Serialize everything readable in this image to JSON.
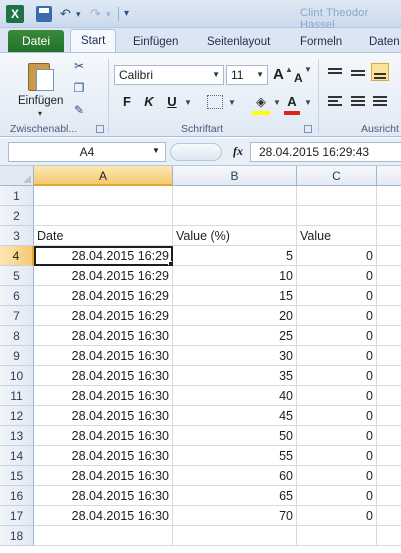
{
  "app": {
    "title": "Clint Theodor Hassel"
  },
  "quick_access": {
    "save": "save-icon",
    "undo": "undo-icon",
    "redo": "redo-icon",
    "customize": "▾"
  },
  "tabs": [
    {
      "label": "Datei"
    },
    {
      "label": "Start"
    },
    {
      "label": "Einfügen"
    },
    {
      "label": "Seitenlayout"
    },
    {
      "label": "Formeln"
    },
    {
      "label": "Daten"
    }
  ],
  "ribbon": {
    "clipboard": {
      "paste_label": "Einfügen",
      "group_label": "Zwischenabl..."
    },
    "font": {
      "name": "Calibri",
      "size": "11",
      "group_label": "Schriftart",
      "bold": "F",
      "italic": "K",
      "underline": "U",
      "grow": "A",
      "shrink": "A",
      "font_color": "A"
    },
    "alignment": {
      "group_label": "Ausricht"
    }
  },
  "formula_bar": {
    "name_box": "A4",
    "fx": "fx",
    "value": "28.04.2015  16:29:43"
  },
  "grid": {
    "columns": [
      "A",
      "B",
      "C"
    ],
    "active_column": "A",
    "active_row": 4,
    "rows": [
      {
        "n": "1",
        "a": "",
        "b": "",
        "c": ""
      },
      {
        "n": "2",
        "a": "",
        "b": "",
        "c": ""
      },
      {
        "n": "3",
        "a": "Date",
        "b": "Value (%)",
        "c": "Value"
      },
      {
        "n": "4",
        "a": "28.04.2015 16:29",
        "b": "5",
        "c": "0"
      },
      {
        "n": "5",
        "a": "28.04.2015 16:29",
        "b": "10",
        "c": "0"
      },
      {
        "n": "6",
        "a": "28.04.2015 16:29",
        "b": "15",
        "c": "0"
      },
      {
        "n": "7",
        "a": "28.04.2015 16:29",
        "b": "20",
        "c": "0"
      },
      {
        "n": "8",
        "a": "28.04.2015 16:30",
        "b": "25",
        "c": "0"
      },
      {
        "n": "9",
        "a": "28.04.2015 16:30",
        "b": "30",
        "c": "0"
      },
      {
        "n": "10",
        "a": "28.04.2015 16:30",
        "b": "35",
        "c": "0"
      },
      {
        "n": "11",
        "a": "28.04.2015 16:30",
        "b": "40",
        "c": "0"
      },
      {
        "n": "12",
        "a": "28.04.2015 16:30",
        "b": "45",
        "c": "0"
      },
      {
        "n": "13",
        "a": "28.04.2015 16:30",
        "b": "50",
        "c": "0"
      },
      {
        "n": "14",
        "a": "28.04.2015 16:30",
        "b": "55",
        "c": "0"
      },
      {
        "n": "15",
        "a": "28.04.2015 16:30",
        "b": "60",
        "c": "0"
      },
      {
        "n": "16",
        "a": "28.04.2015 16:30",
        "b": "65",
        "c": "0"
      },
      {
        "n": "17",
        "a": "28.04.2015 16:30",
        "b": "70",
        "c": "0"
      },
      {
        "n": "18",
        "a": "",
        "b": "",
        "c": ""
      }
    ]
  },
  "colors": {
    "accent": "#1f7246",
    "file_tab": "#2a7d2e",
    "active_header": "#f5c971"
  }
}
